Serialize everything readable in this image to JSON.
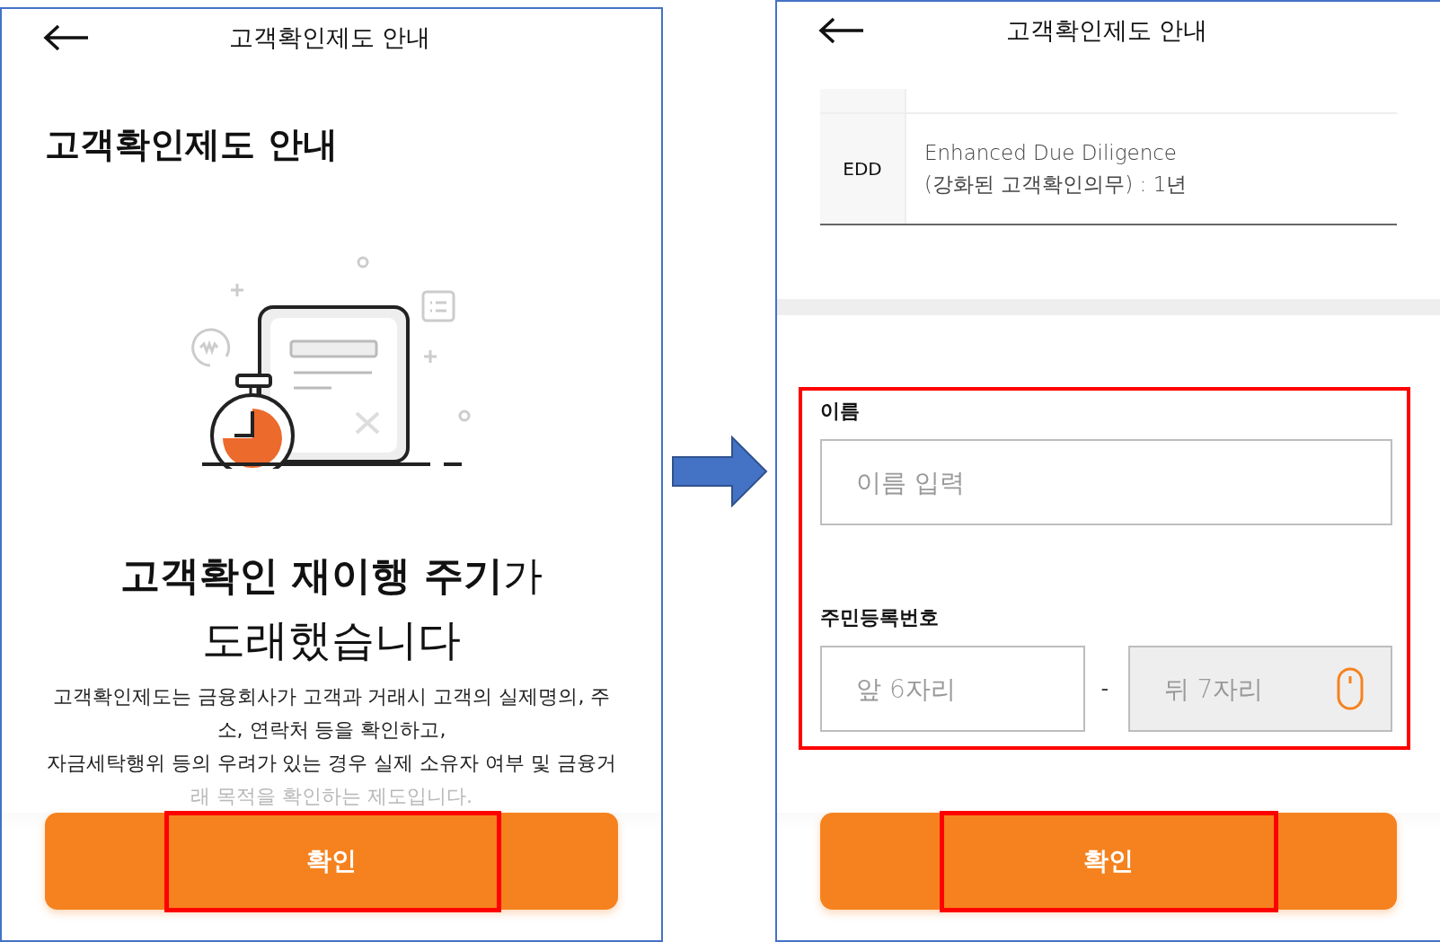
{
  "left_screen": {
    "header_title": "고객확인제도 안내",
    "page_title": "고객확인제도 안내",
    "headline": "**고객확인 재이행 주기**가",
    "headline_line_2": "도래했습니다",
    "description_lines": [
      "고객확인제도는 금융회사가 고객과 거래시 고객의 실제명의, 주",
      "소, 연락처 등을 확인하고,",
      "자금세탁행위 등의 우려가 있는 경우 실제 소유자 여부 및 금융거"
    ],
    "faded_line": "래 목적을 확인하는 제도입니다.",
    "confirm_button": {
      "label": "확인",
      "highlighted": true
    }
  },
  "right_screen": {
    "header_title": "고객확인제도 안내",
    "table_rows": [
      {
        "label": "EDD",
        "value_lines": [
          "Enhanced Due Diligence",
          "(강화된 고객확인의무) : 1년"
        ]
      }
    ],
    "form": {
      "highlighted": true,
      "fields": [
        {
          "kind": "text",
          "label": "이름",
          "placeholder": "이름 입력"
        },
        {
          "kind": "split",
          "label": "주민등록번호",
          "separator": "-",
          "parts": [
            {
              "placeholder": "앞 6자리",
              "secure": false
            },
            {
              "placeholder": "뒤 7자리",
              "secure": true
            }
          ]
        }
      ]
    },
    "confirm_button": {
      "label": "확인",
      "highlighted": true
    }
  }
}
